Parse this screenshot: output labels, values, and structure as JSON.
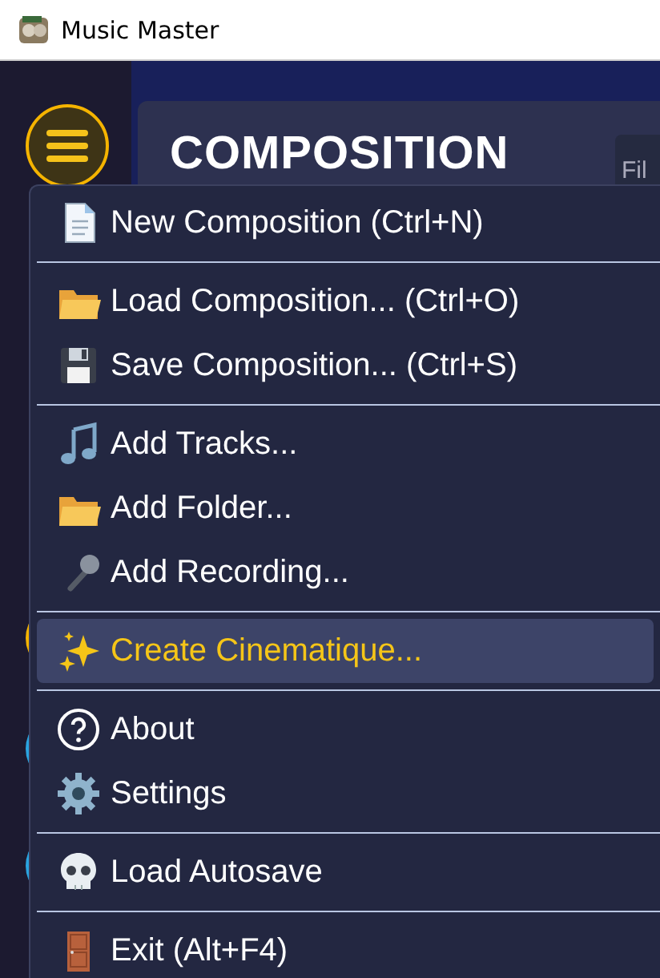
{
  "window": {
    "title": "Music Master"
  },
  "page": {
    "heading": "COMPOSITION",
    "side_panel_text": "Fil"
  },
  "menu": {
    "sections": [
      {
        "items": [
          {
            "label": "New Composition (Ctrl+N)",
            "selected": false
          }
        ]
      },
      {
        "items": [
          {
            "label": "Load Composition... (Ctrl+O)",
            "selected": false
          },
          {
            "label": "Save Composition... (Ctrl+S)",
            "selected": false
          }
        ]
      },
      {
        "items": [
          {
            "label": "Add Tracks...",
            "selected": false
          },
          {
            "label": "Add Folder...",
            "selected": false
          },
          {
            "label": "Add Recording...",
            "selected": false
          }
        ]
      },
      {
        "items": [
          {
            "label": "Create Cinematique...",
            "selected": true
          }
        ]
      },
      {
        "items": [
          {
            "label": "About",
            "selected": false
          },
          {
            "label": "Settings",
            "selected": false
          }
        ]
      },
      {
        "items": [
          {
            "label": "Load Autosave",
            "selected": false
          }
        ]
      },
      {
        "items": [
          {
            "label": "Exit (Alt+F4)",
            "selected": false
          }
        ]
      }
    ]
  }
}
